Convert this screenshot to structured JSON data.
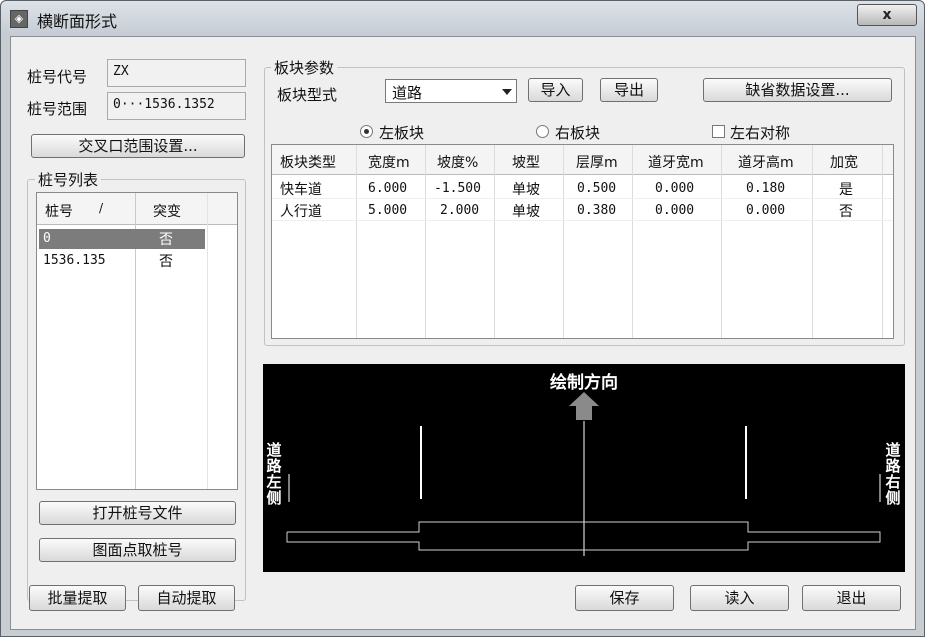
{
  "window": {
    "title": "横断面形式",
    "app_icon": "app-icon",
    "close_label": "x"
  },
  "station": {
    "code_label": "桩号代号",
    "code_value": "ZX",
    "range_label": "桩号范围",
    "range_value": "0···1536.1352",
    "cross_btn": "交叉口范围设置..."
  },
  "station_list": {
    "title": "桩号列表",
    "columns": [
      "桩号",
      "突变"
    ],
    "sort_glyph": "/",
    "rows": [
      {
        "station": "0",
        "mutation": "否",
        "selected": true
      },
      {
        "station": "1536.135",
        "mutation": "否",
        "selected": false
      }
    ],
    "open_btn": "打开桩号文件",
    "pick_btn": "图面点取桩号"
  },
  "bottom_left": {
    "batch_btn": "批量提取",
    "auto_btn": "自动提取"
  },
  "block": {
    "group_title": "板块参数",
    "type_label": "板块型式",
    "type_value": "道路",
    "import_btn": "导入",
    "export_btn": "导出",
    "default_btn": "缺省数据设置...",
    "left_radio": "左板块",
    "right_radio": "右板块",
    "symmetric_check": "左右对称",
    "columns": [
      "板块类型",
      "宽度m",
      "坡度%",
      "坡型",
      "层厚m",
      "道牙宽m",
      "道牙高m",
      "加宽"
    ],
    "rows": [
      [
        "快车道",
        "6.000",
        "-1.500",
        "单坡",
        "0.500",
        "0.000",
        "0.180",
        "是"
      ],
      [
        "人行道",
        "5.000",
        "2.000",
        "单坡",
        "0.380",
        "0.000",
        "0.000",
        "否"
      ]
    ]
  },
  "preview": {
    "direction": "绘制方向",
    "left_side": "道路左侧",
    "right_side": "道路右侧"
  },
  "bottom_right": {
    "save_btn": "保存",
    "load_btn": "读入",
    "exit_btn": "退出"
  }
}
